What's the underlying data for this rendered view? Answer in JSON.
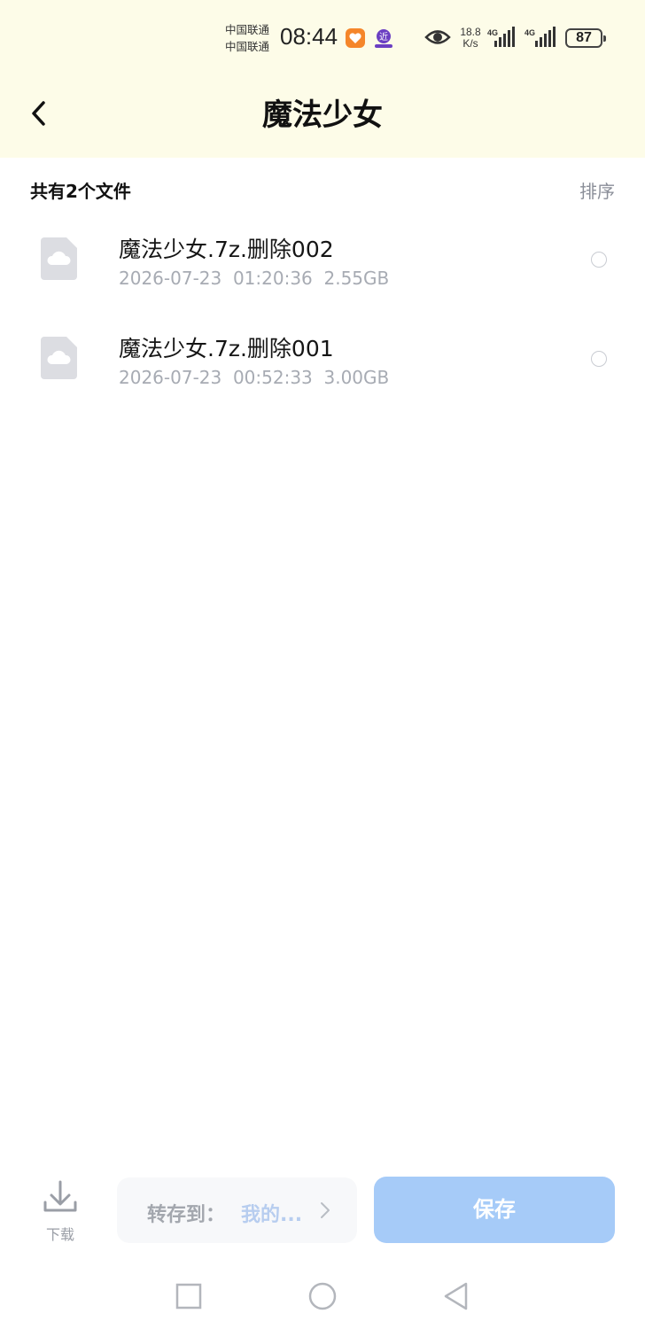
{
  "status_bar": {
    "carrier_1": "中国联通",
    "carrier_2": "中国联通",
    "time": "08:44",
    "net_speed_value": "18.8",
    "net_speed_unit": "K/s",
    "signal_1_label": "4G",
    "signal_2_label": "4G",
    "battery": "87"
  },
  "header": {
    "title": "魔法少女"
  },
  "list": {
    "count_label": "共有2个文件",
    "sort_label": "排序",
    "files": [
      {
        "name": "魔法少女.7z.删除002",
        "date": "2026-07-23",
        "time": "01:20:36",
        "size": "2.55GB"
      },
      {
        "name": "魔法少女.7z.删除001",
        "date": "2026-07-23",
        "time": "00:52:33",
        "size": "3.00GB"
      }
    ]
  },
  "bottom_bar": {
    "download_label": "下载",
    "save_to_label": "转存到：",
    "save_to_value": "我的...",
    "save_button": "保存"
  },
  "colors": {
    "header_bg": "#fdfce8",
    "save_button_bg": "#a6cbf8",
    "meta_text": "#a7abb3"
  }
}
